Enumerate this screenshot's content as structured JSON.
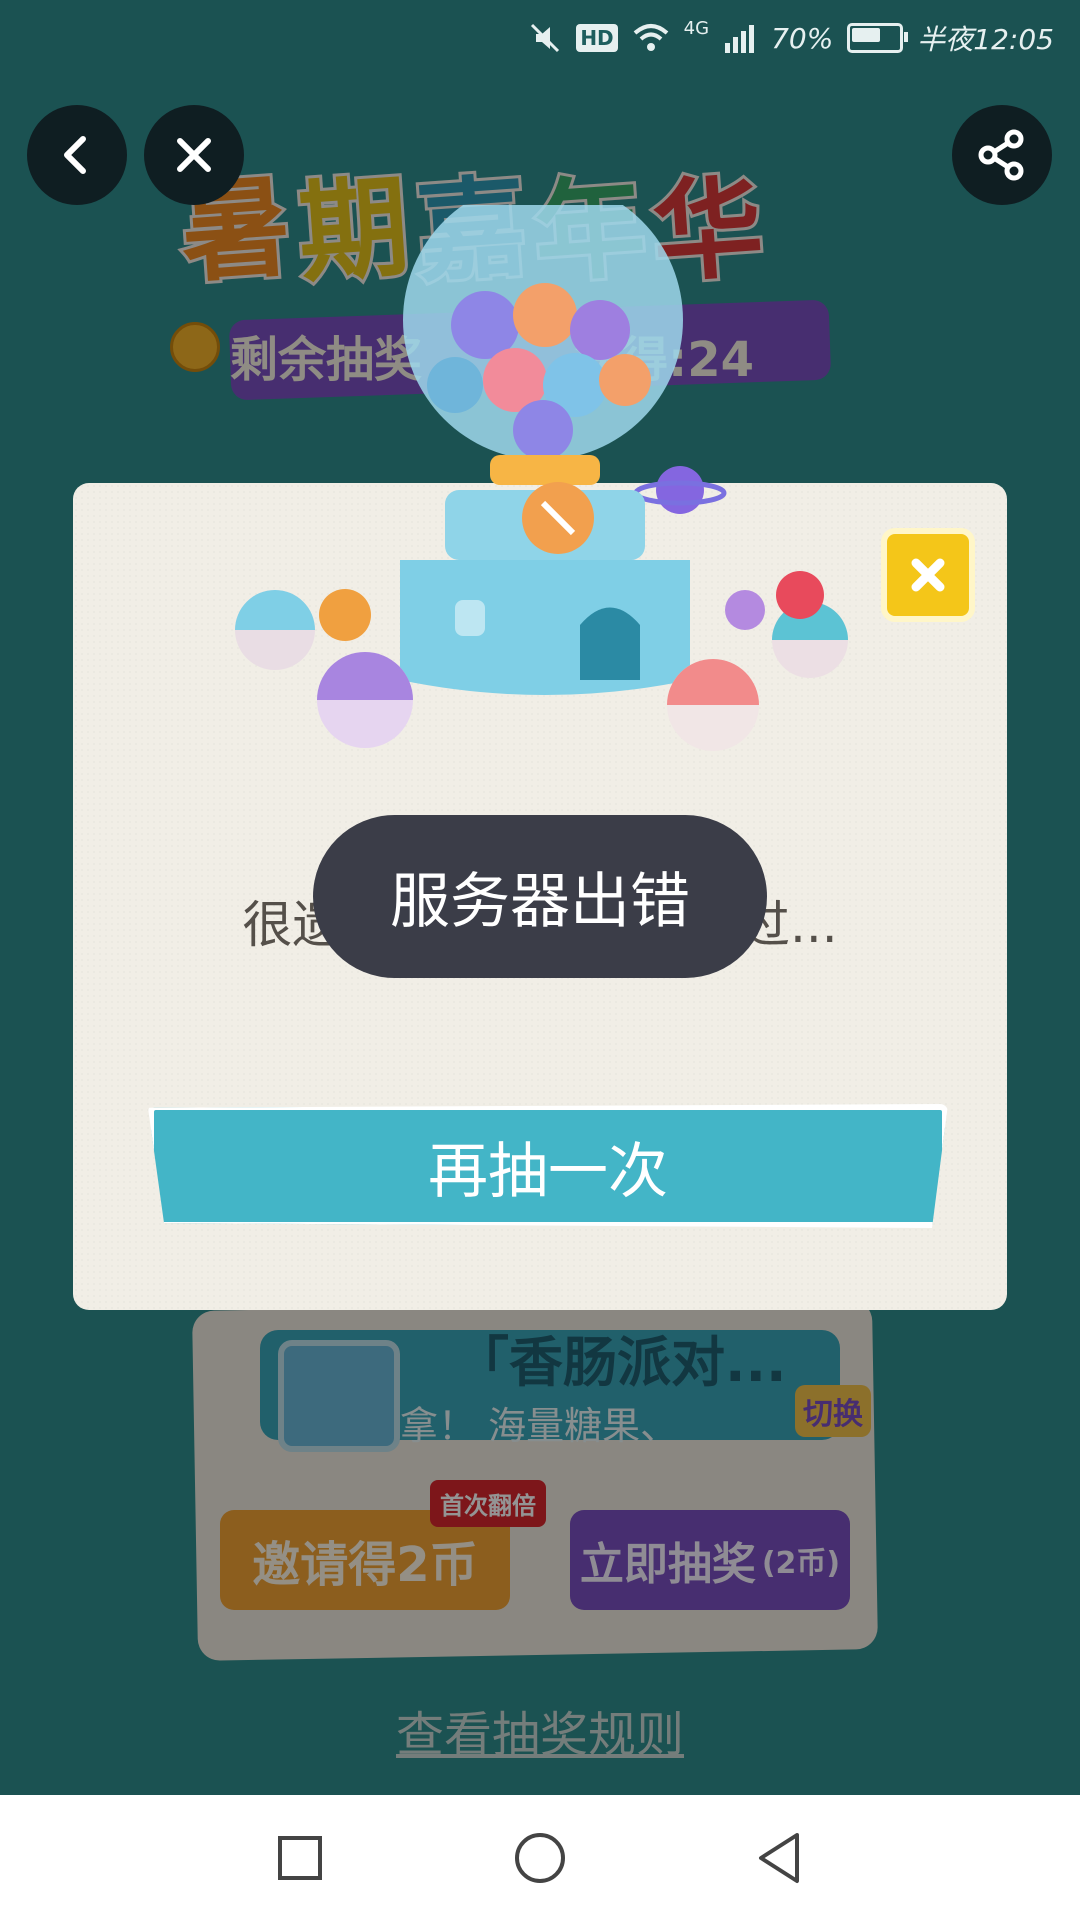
{
  "status_bar": {
    "network": "4G",
    "hd": "HD",
    "battery": "70%",
    "battery_level": 0.7,
    "time": "半夜12:05"
  },
  "nav": {
    "back_icon": "chevron-left-icon",
    "close_icon": "close-icon",
    "share_icon": "share-icon"
  },
  "background_page": {
    "headline_chars": [
      "暑",
      "期",
      "嘉",
      "年",
      "华"
    ],
    "headline_colors": [
      "#f08a24",
      "#e3c21b",
      "#2f9ab5",
      "#38a96a",
      "#d93a3a"
    ],
    "remaining_text": "剩余抽奖",
    "obtained_text": "获得:24",
    "game_title": "「香肠派对...",
    "game_desc": "拿！    海量糖果、",
    "switch_label": "切换",
    "invite_button": "邀请得2币",
    "first_double_tag": "首次翻倍",
    "draw_button": "立即抽奖",
    "draw_cost": "(2币)",
    "rules_link": "查看抽奖规则"
  },
  "modal": {
    "message": "很遗憾...与奖品擦肩而过...",
    "retry_button": "再抽一次"
  },
  "toast": {
    "text": "服务器出错"
  },
  "system_nav": {
    "recents_icon": "square-icon",
    "home_icon": "circle-icon",
    "back_icon": "triangle-back-icon"
  },
  "colors": {
    "background": "#2f8e8e",
    "modal": "#f1eee6",
    "retry_button": "#43b5c7",
    "toast": "#3b3d48",
    "close_yellow": "#f4c619",
    "purple": "#7b50c2",
    "orange": "#f2a334"
  }
}
